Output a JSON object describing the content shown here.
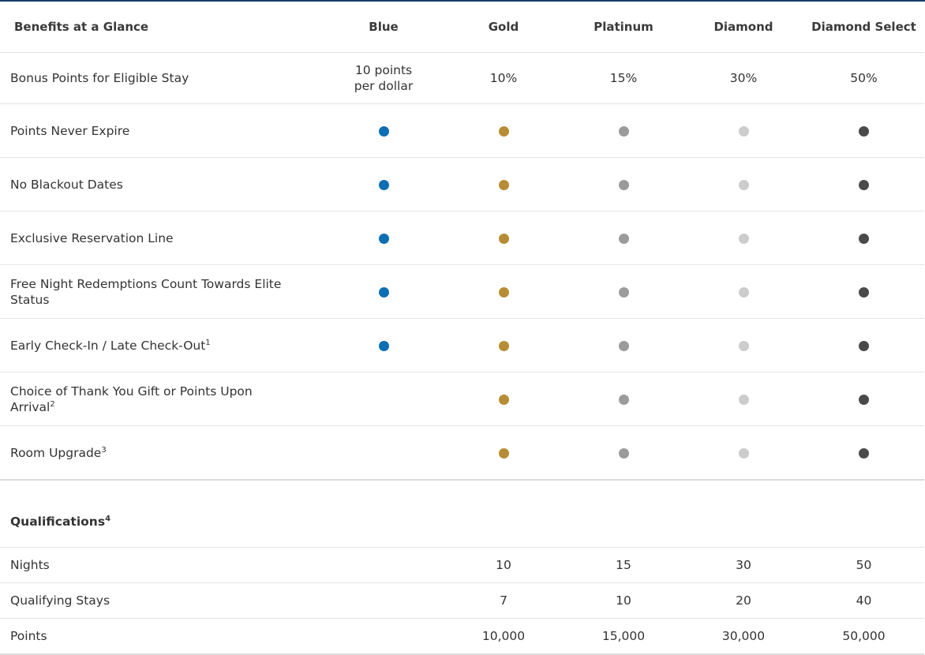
{
  "colors": {
    "blue": "#0c6fb3",
    "gold": "#b68d36",
    "platinum": "#9b9b9b",
    "diamond": "#cccccc",
    "diamond_select": "#4a4a4a",
    "top_border": "#1b3d6e"
  },
  "header": {
    "title": "Benefits at a Glance",
    "tiers": [
      "Blue",
      "Gold",
      "Platinum",
      "Diamond",
      "Diamond Select"
    ]
  },
  "benefits": [
    {
      "label": "Bonus Points for Eligible Stay",
      "sup": "",
      "values": [
        "10 points per dollar",
        "10%",
        "15%",
        "30%",
        "50%"
      ]
    },
    {
      "label": "Points Never Expire",
      "sup": "",
      "dots": [
        true,
        true,
        true,
        true,
        true
      ]
    },
    {
      "label": "No Blackout Dates",
      "sup": "",
      "dots": [
        true,
        true,
        true,
        true,
        true
      ]
    },
    {
      "label": "Exclusive Reservation Line",
      "sup": "",
      "dots": [
        true,
        true,
        true,
        true,
        true
      ]
    },
    {
      "label": "Free Night Redemptions Count Towards Elite Status",
      "sup": "",
      "dots": [
        true,
        true,
        true,
        true,
        true
      ]
    },
    {
      "label": "Early Check-In / Late Check-Out",
      "sup": "1",
      "dots": [
        true,
        true,
        true,
        true,
        true
      ]
    },
    {
      "label": "Choice of Thank You Gift or Points Upon Arrival",
      "sup": "2",
      "dots": [
        false,
        true,
        true,
        true,
        true
      ]
    },
    {
      "label": "Room Upgrade",
      "sup": "3",
      "dots": [
        false,
        true,
        true,
        true,
        true
      ]
    }
  ],
  "qualifications": {
    "title": "Qualifications",
    "sup": "4",
    "rows": [
      {
        "label": "Nights",
        "values": [
          "",
          "10",
          "15",
          "30",
          "50"
        ]
      },
      {
        "label": "Qualifying Stays",
        "values": [
          "",
          "7",
          "10",
          "20",
          "40"
        ]
      },
      {
        "label": "Points",
        "values": [
          "",
          "10,000",
          "15,000",
          "30,000",
          "50,000"
        ]
      }
    ]
  }
}
